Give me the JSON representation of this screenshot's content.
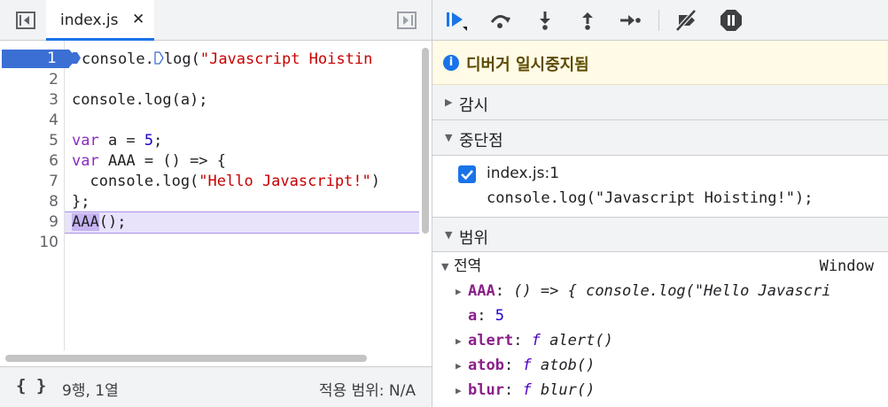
{
  "editor": {
    "tab_label": "index.js",
    "tab_close": "✕",
    "line_numbers": [
      "1",
      "2",
      "3",
      "4",
      "5",
      "6",
      "7",
      "8",
      "9",
      "10"
    ],
    "lines": {
      "l1_a": "console.",
      "l1_b": "log(",
      "l1_str": "\"Javascript Hoistin",
      "l3": "console.log(a);",
      "l5_kw": "var",
      "l5_mid": " a = ",
      "l5_num": "5",
      "l5_end": ";",
      "l6_kw": "var",
      "l6_rest": " AAA = () => {",
      "l7_a": "  console.log(",
      "l7_str": "\"Hello Javascript!\"",
      "l7_end": ")",
      "l8": "};",
      "l9_hl": "AAA",
      "l9_rest": "();"
    }
  },
  "status": {
    "braces": "{ }",
    "cursor": "9행, 1열",
    "scope": "적용 범위: N/A"
  },
  "debugger": {
    "paused_message": "디버거 일시중지됨",
    "sections": {
      "watch": "감시",
      "breakpoints": "중단점",
      "scope": "범위"
    },
    "breakpoint": {
      "file": "index.js:1",
      "code": "console.log(\"Javascript Hoisting!\");"
    },
    "scope": {
      "global_label": "전역",
      "global_value": "Window",
      "props": [
        {
          "name": "AAA",
          "value": "() => { console.log(\"Hello Javascri"
        },
        {
          "name": "a",
          "value": "5"
        },
        {
          "name": "alert",
          "fkw": "f",
          "value": " alert()"
        },
        {
          "name": "atob",
          "fkw": "f",
          "value": " atob()"
        },
        {
          "name": "blur",
          "fkw": "f",
          "value": " blur()"
        }
      ]
    }
  },
  "colors": {
    "accent": "#1a73e8",
    "breakpoint": "#3b6fd4",
    "exec_line": "#e8e2fb",
    "banner": "#fffbe6"
  }
}
